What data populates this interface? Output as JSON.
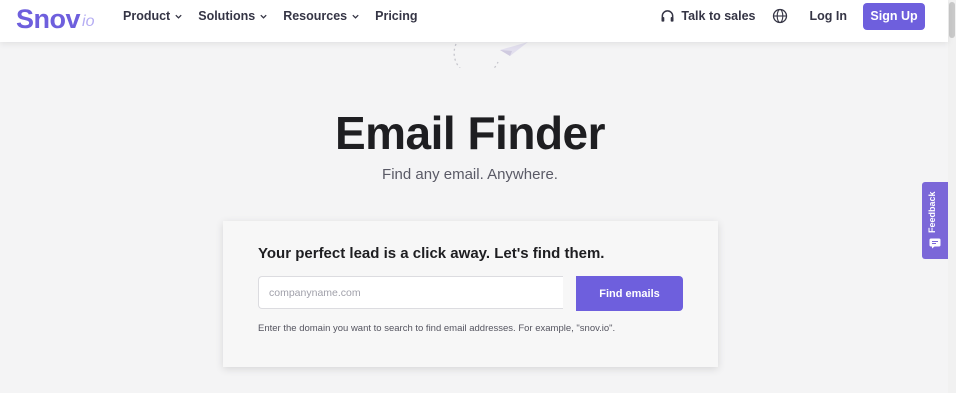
{
  "brand": {
    "logo_main": "Snov",
    "logo_suffix": "io",
    "accent_color": "#6e5fdd"
  },
  "nav": {
    "items": [
      {
        "label": "Product",
        "icon": "chevron-down-icon"
      },
      {
        "label": "Solutions",
        "icon": "chevron-down-icon"
      },
      {
        "label": "Resources",
        "icon": "chevron-down-icon"
      },
      {
        "label": "Pricing"
      }
    ],
    "talk_to_sales": "Talk to sales",
    "talk_icon": "headset-icon",
    "language_icon": "globe-icon",
    "login": "Log In",
    "signup": "Sign Up"
  },
  "hero": {
    "title": "Email Finder",
    "subtitle": "Find any email. Anywhere."
  },
  "search_card": {
    "heading": "Your perfect lead is a click away. Let's find them.",
    "input_placeholder": "companyname.com",
    "input_value": "",
    "button_label": "Find emails",
    "hint": "Enter the domain you want to search to find email addresses. For example, \"snov.io\"."
  },
  "feedback": {
    "label": "Feedback",
    "icon": "chat-icon",
    "color": "#7b67d8"
  }
}
